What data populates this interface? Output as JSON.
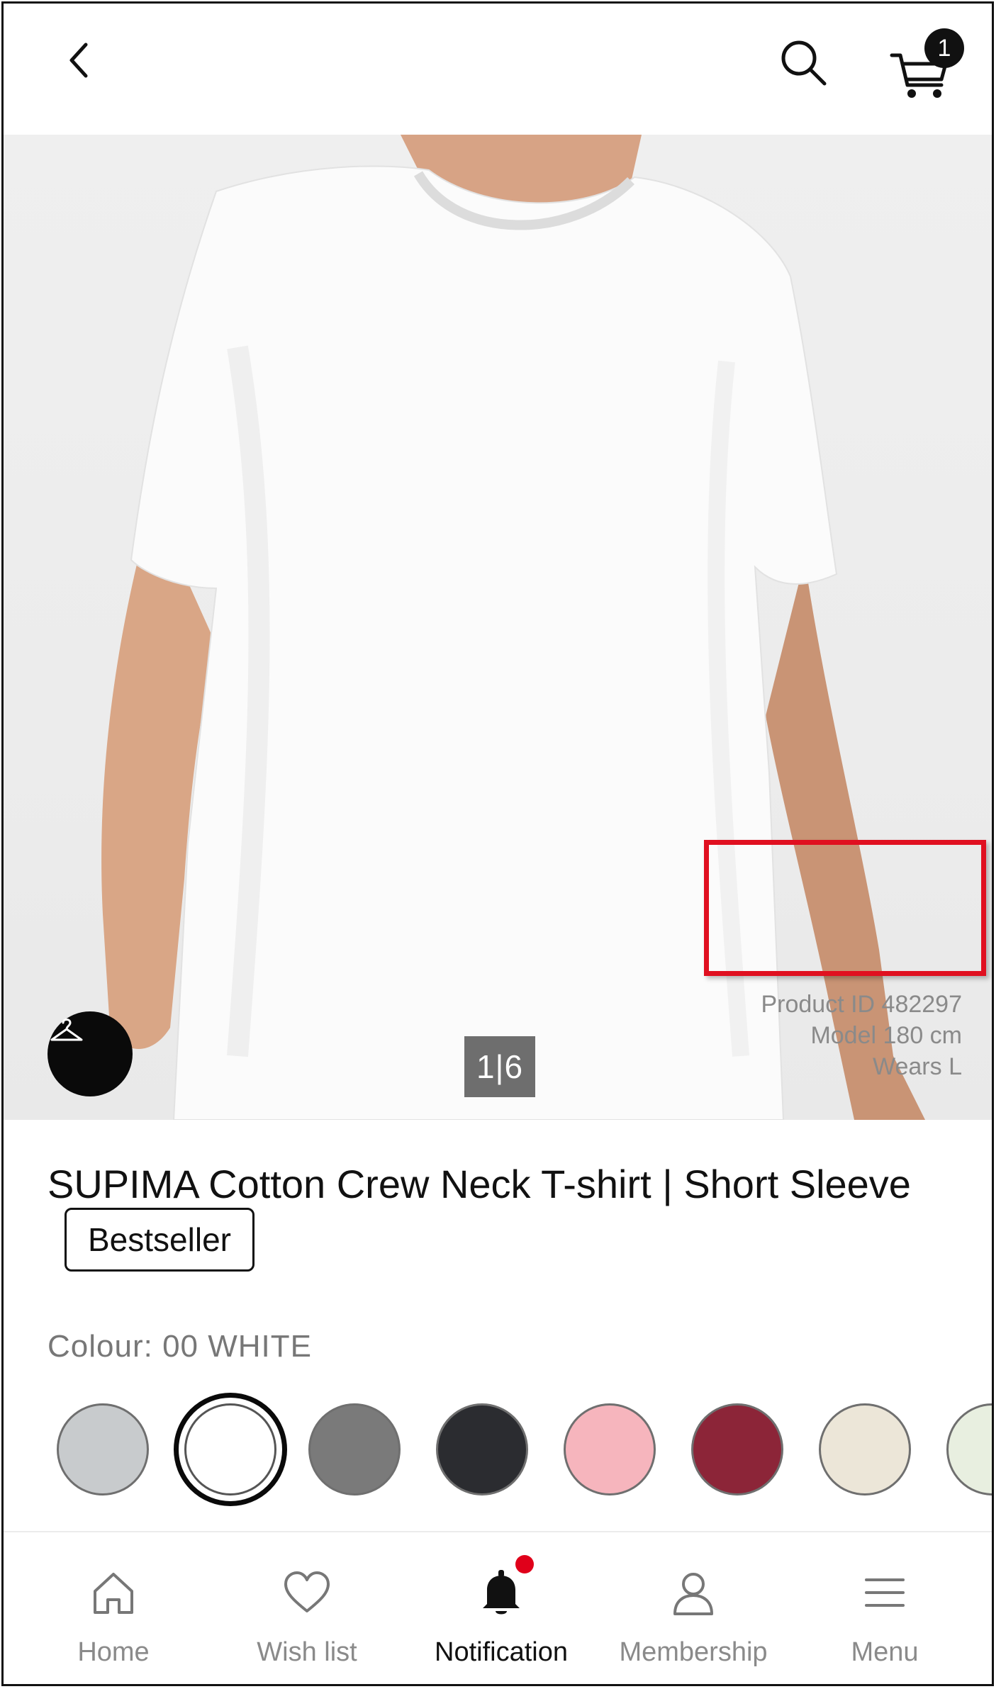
{
  "header": {
    "back_icon": "chevron-left-icon",
    "search_icon": "search-icon",
    "cart_icon": "cart-icon",
    "cart_count": "1"
  },
  "hero": {
    "hanger_icon": "hanger-icon",
    "image_counter": "1|6",
    "product_info_lines": [
      "Product ID 482297",
      "Model 180 cm",
      "Wears L"
    ]
  },
  "product": {
    "title": "SUPIMA Cotton Crew Neck T-shirt | Short Sleeve",
    "badge": "Bestseller",
    "colour_label": "Colour: 00 WHITE",
    "swatches": [
      {
        "color": "#c8cbcd"
      },
      {
        "color": "#ffffff",
        "selected": true
      },
      {
        "color": "#7a7a7a"
      },
      {
        "color": "#2b2c30"
      },
      {
        "color": "#f6b5bd"
      },
      {
        "color": "#8c2538"
      },
      {
        "color": "#ece6d8"
      },
      {
        "color": "#e8efe0"
      }
    ]
  },
  "bottom_nav": {
    "items": [
      {
        "label": "Home",
        "icon": "home-icon"
      },
      {
        "label": "Wish list",
        "icon": "heart-icon"
      },
      {
        "label": "Notification",
        "icon": "bell-icon",
        "active": true
      },
      {
        "label": "Membership",
        "icon": "user-icon"
      },
      {
        "label": "Menu",
        "icon": "menu-icon"
      }
    ]
  },
  "colors": {
    "highlight": "#e01020",
    "notification_dot": "#e0001a"
  }
}
